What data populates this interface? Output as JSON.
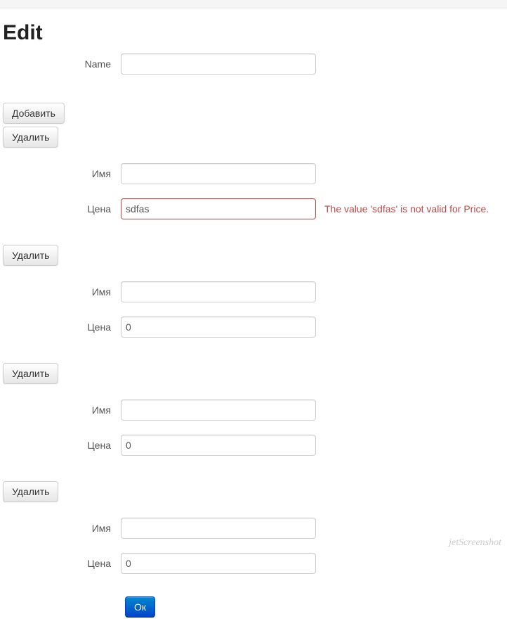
{
  "header": {
    "title": "Edit"
  },
  "main_form": {
    "name_label": "Name",
    "name_value": ""
  },
  "buttons": {
    "add": "Добавить",
    "delete": "Удалить",
    "submit": "Ок"
  },
  "item_labels": {
    "name": "Имя",
    "price": "Цена"
  },
  "items": [
    {
      "name": "",
      "price": "sdfas",
      "price_error": "The value 'sdfas' is not valid for Price."
    },
    {
      "name": "",
      "price": "0",
      "price_error": ""
    },
    {
      "name": "",
      "price": "0",
      "price_error": ""
    },
    {
      "name": "",
      "price": "0",
      "price_error": ""
    }
  ],
  "watermark": "jetScreenshot"
}
